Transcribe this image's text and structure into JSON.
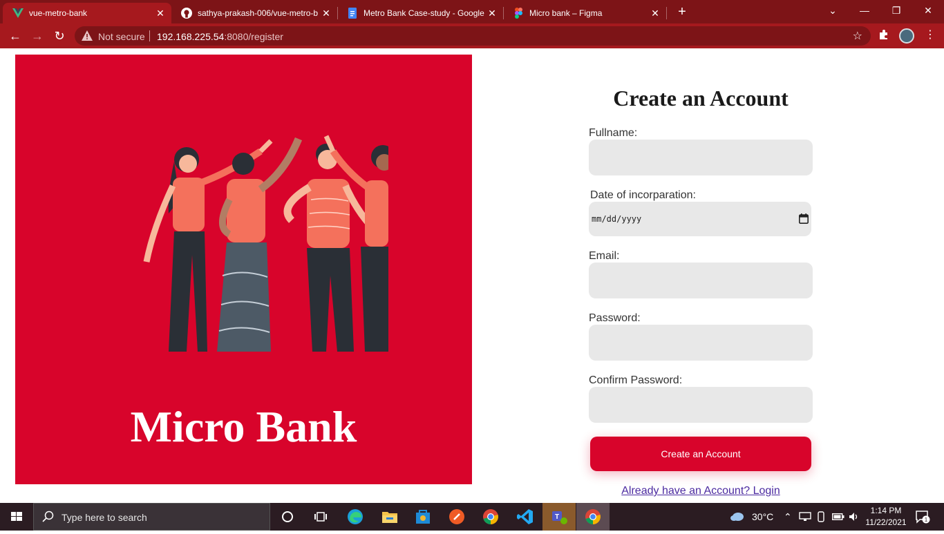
{
  "browser": {
    "tabs": [
      {
        "title": "vue-metro-bank",
        "icon": "vue-icon",
        "active": true
      },
      {
        "title": "sathya-prakash-006/vue-metro-b",
        "icon": "github-icon",
        "active": false
      },
      {
        "title": "Metro Bank Case-study - Google",
        "icon": "google-docs-icon",
        "active": false
      },
      {
        "title": "Micro bank – Figma",
        "icon": "figma-icon",
        "active": false
      }
    ],
    "security_label": "Not secure",
    "url_host": "192.168.225.54",
    "url_rest": ":8080/register",
    "theme_color": "#a6191e"
  },
  "hero": {
    "title": "Micro Bank",
    "background": "#d8042b"
  },
  "form": {
    "title": "Create an Account",
    "fields": [
      {
        "label": "Fullname:",
        "value": ""
      },
      {
        "label": "Date of incorparation:",
        "placeholder": "mm/dd/yyyy"
      },
      {
        "label": "Email:",
        "value": ""
      },
      {
        "label": "Password:",
        "value": ""
      },
      {
        "label": "Confirm Password:",
        "value": ""
      }
    ],
    "submit_label": "Create an Account",
    "login_link": "Already have an Account? Login"
  },
  "taskbar": {
    "search_placeholder": "Type here to search",
    "weather": "30°C",
    "time": "1:14 PM",
    "date": "11/22/2021",
    "notification_count": "1"
  }
}
